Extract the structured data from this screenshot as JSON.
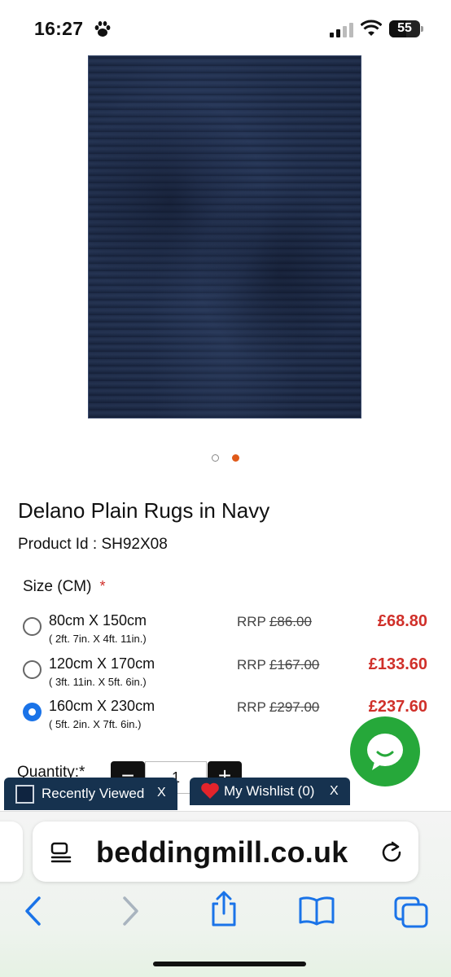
{
  "status_bar": {
    "time": "16:27",
    "battery": "55",
    "battery_level": 0.55
  },
  "gallery": {
    "dot_count": 2,
    "active_dot": 2
  },
  "product": {
    "title": "Delano Plain Rugs in Navy",
    "product_id": "Product Id : SH92X08",
    "color_rug": "#1f2d4a"
  },
  "size": {
    "label": "Size (CM)",
    "required_mark": "*",
    "options": [
      {
        "size": "80cm X 150cm",
        "imperial": "( 2ft. 7in. X 4ft. 11in.)",
        "rrp_label": "RRP",
        "rrp_price": "£86.00",
        "price": "£68.80",
        "selected": false
      },
      {
        "size": "120cm X 170cm",
        "imperial": "( 3ft. 11in. X 5ft. 6in.)",
        "rrp_label": "RRP",
        "rrp_price": "£167.00",
        "price": "£133.60",
        "selected": false
      },
      {
        "size": "160cm X 230cm",
        "imperial": "( 5ft. 2in. X 7ft. 6in.)",
        "rrp_label": "RRP",
        "rrp_price": "£297.00",
        "price": "£237.60",
        "selected": true
      }
    ]
  },
  "quantity": {
    "label": "Quantity:*",
    "value": "1",
    "minus": "−",
    "plus": "+"
  },
  "recently_viewed": {
    "label": "Recently Viewed",
    "close": "X"
  },
  "wishlist": {
    "label": "My Wishlist (0)",
    "close": "X"
  },
  "browser": {
    "url": "beddingmill.co.uk"
  },
  "colors": {
    "accent_blue": "#1a73e8",
    "sale_red": "#d0302a",
    "chat_green": "#26a83a",
    "bar_navy": "#16324f",
    "dot_orange": "#e05a1a"
  }
}
